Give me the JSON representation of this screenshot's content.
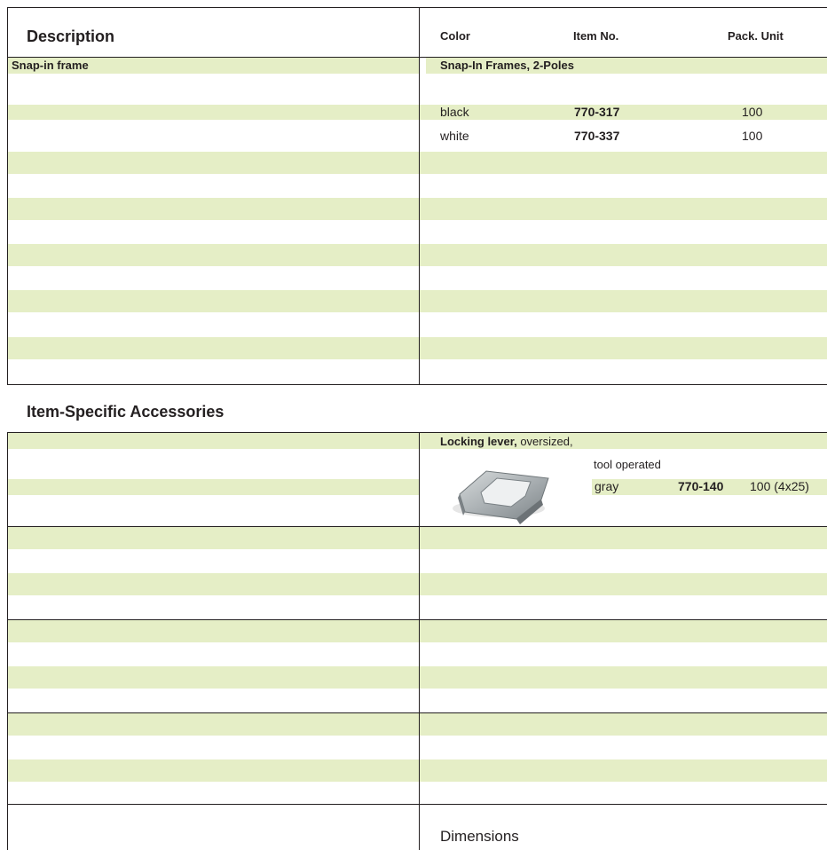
{
  "header": {
    "description": "Description",
    "color": "Color",
    "item_no": "Item No.",
    "pack_unit": "Pack. Unit"
  },
  "section1": {
    "left_title": "Snap-in frame",
    "right_title": "Snap-In Frames, 2-Poles",
    "rows": [
      {
        "color": "black",
        "item_no": "770-317",
        "pack_unit": "100"
      },
      {
        "color": "white",
        "item_no": "770-337",
        "pack_unit": "100"
      }
    ]
  },
  "accessories": {
    "heading": "Item-Specific Accessories",
    "product_bold": "Locking lever,",
    "product_rest": " oversized,",
    "product_line2": "tool operated",
    "row": {
      "color": "gray",
      "item_no": "770-140",
      "pack_unit": "100 (4x25)"
    },
    "image_icon": "locking-lever-image"
  },
  "footer": {
    "dimensions": "Dimensions"
  },
  "colors": {
    "band": "#e5eec6",
    "text": "#231f20"
  }
}
